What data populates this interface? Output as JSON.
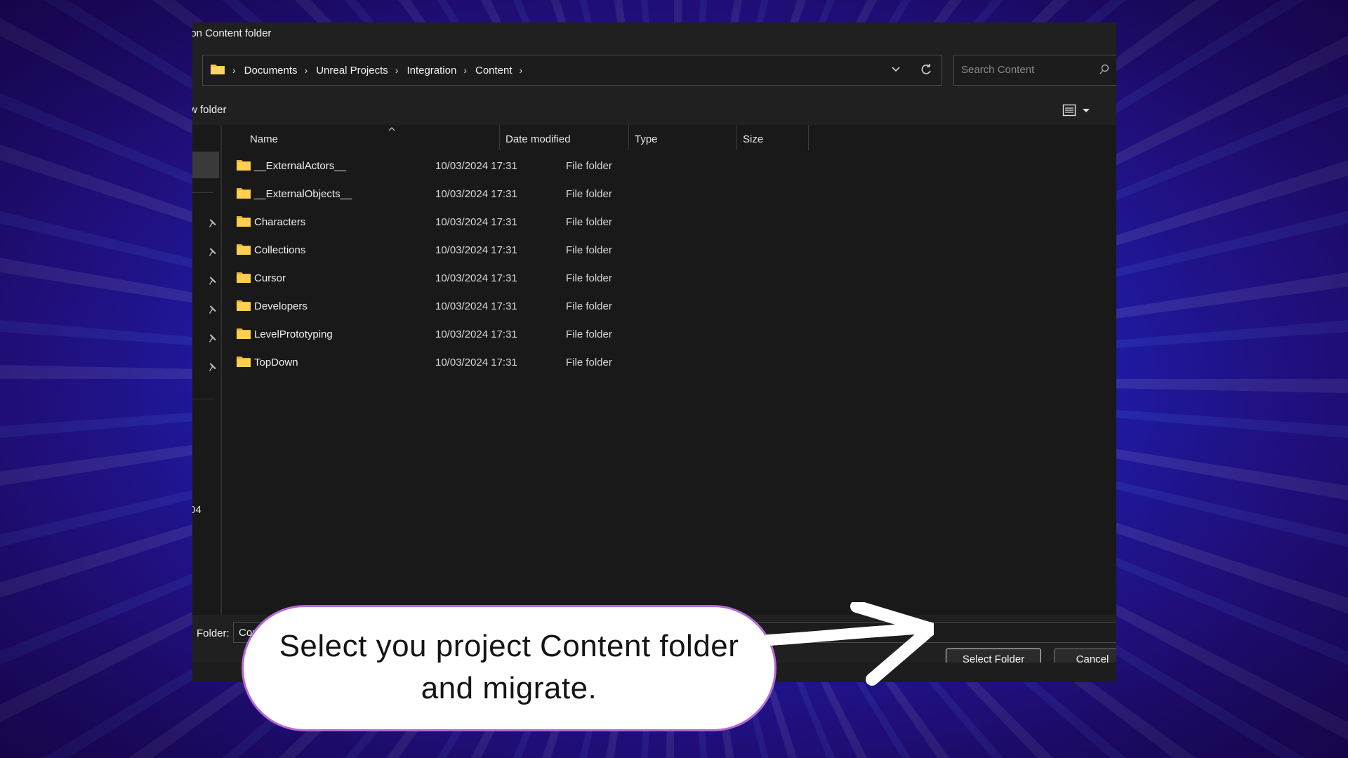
{
  "window": {
    "title": "ion Content folder"
  },
  "address_bar": {
    "breadcrumbs": [
      "Documents",
      "Unreal Projects",
      "Integration",
      "Content"
    ],
    "search_placeholder": "Search Content"
  },
  "toolbar": {
    "new_folder_label": "w folder"
  },
  "nav_pane": {
    "partial_text": "04"
  },
  "file_list": {
    "columns": [
      "Name",
      "Date modified",
      "Type",
      "Size"
    ],
    "rows": [
      {
        "name": "__ExternalActors__",
        "date": "10/03/2024 17:31",
        "type": "File folder"
      },
      {
        "name": "__ExternalObjects__",
        "date": "10/03/2024 17:31",
        "type": "File folder"
      },
      {
        "name": "Characters",
        "date": "10/03/2024 17:31",
        "type": "File folder"
      },
      {
        "name": "Collections",
        "date": "10/03/2024 17:31",
        "type": "File folder"
      },
      {
        "name": "Cursor",
        "date": "10/03/2024 17:31",
        "type": "File folder"
      },
      {
        "name": "Developers",
        "date": "10/03/2024 17:31",
        "type": "File folder"
      },
      {
        "name": "LevelPrototyping",
        "date": "10/03/2024 17:31",
        "type": "File folder"
      },
      {
        "name": "TopDown",
        "date": "10/03/2024 17:31",
        "type": "File folder"
      }
    ]
  },
  "footer": {
    "folder_label": "Folder:",
    "folder_value": "Content",
    "select_button": "Select Folder",
    "cancel_button": "Cancel"
  },
  "callout": {
    "line1": "Select you project Content folder",
    "line2": "and migrate."
  },
  "colors": {
    "folder_yellow": "#f4c542",
    "callout_border": "#b46ad6",
    "dialog_bg": "#191919"
  }
}
